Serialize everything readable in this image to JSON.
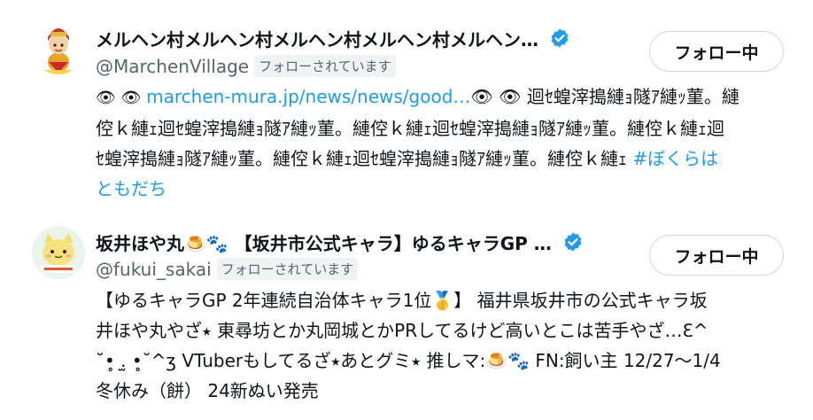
{
  "users": [
    {
      "name": "メルヘン村メルヘン村メルヘン村メルヘン村メルヘン…",
      "handle": "@MarchenVillage",
      "follows_you": "フォローされています",
      "follow_button": "フォロー中",
      "bio_lines": [
        {
          "prefix": "👁 👁 ",
          "link": "marchen-mura.jp/news/news/good…",
          "suffix": "👁 👁 迴ｾ蝗滓搗縺ｮ隧ｱ縺ｯ菫。縺"
        },
        {
          "text": "倥ｋ縺ｪ迴ｾ蝗滓搗縺ｮ隧ｱ縺ｯ菫。縺倥ｋ縺ｪ迴ｾ蝗滓搗縺ｮ隧ｱ縺ｯ菫。縺倥ｋ縺ｪ迴"
        },
        {
          "text": "ｾ蝗滓搗縺ｮ隧ｱ縺ｯ菫。縺倥ｋ縺ｪ迴ｾ蝗滓搗縺ｮ隧ｱ縺ｯ菫。縺倥ｋ縺ｪ ",
          "hashtag": "#ぼくらは"
        },
        {
          "hashtag": "ともだち"
        }
      ]
    },
    {
      "name": "坂井ほや丸🍮🐾 【坂井市公式キャラ】ゆるキャラGP …",
      "handle": "@fukui_sakai",
      "follows_you": "フォローされています",
      "follow_button": "フォロー中",
      "bio_lines": [
        "【ゆるキャラGP 2年連続自治体キャラ1位🥇】 福井県坂井市の公式キャラ坂",
        "井ほや丸やざ⭑ 東尋坊とか丸岡城とかPRしてるけど高いとこは苦手やざ…ℇ^",
        "˘•̥ .̫ •̥˘^ʒ VTuberもしてるざ⭑あとグミ⭑ 推しマ:🍮🐾 FN:飼い主 12/27〜1/4",
        "冬休み（餅） 24新ぬい発売"
      ]
    }
  ],
  "colors": {
    "link": "#1d9bf0",
    "verified": "#1d9bf0",
    "secondary_text": "#536471"
  }
}
